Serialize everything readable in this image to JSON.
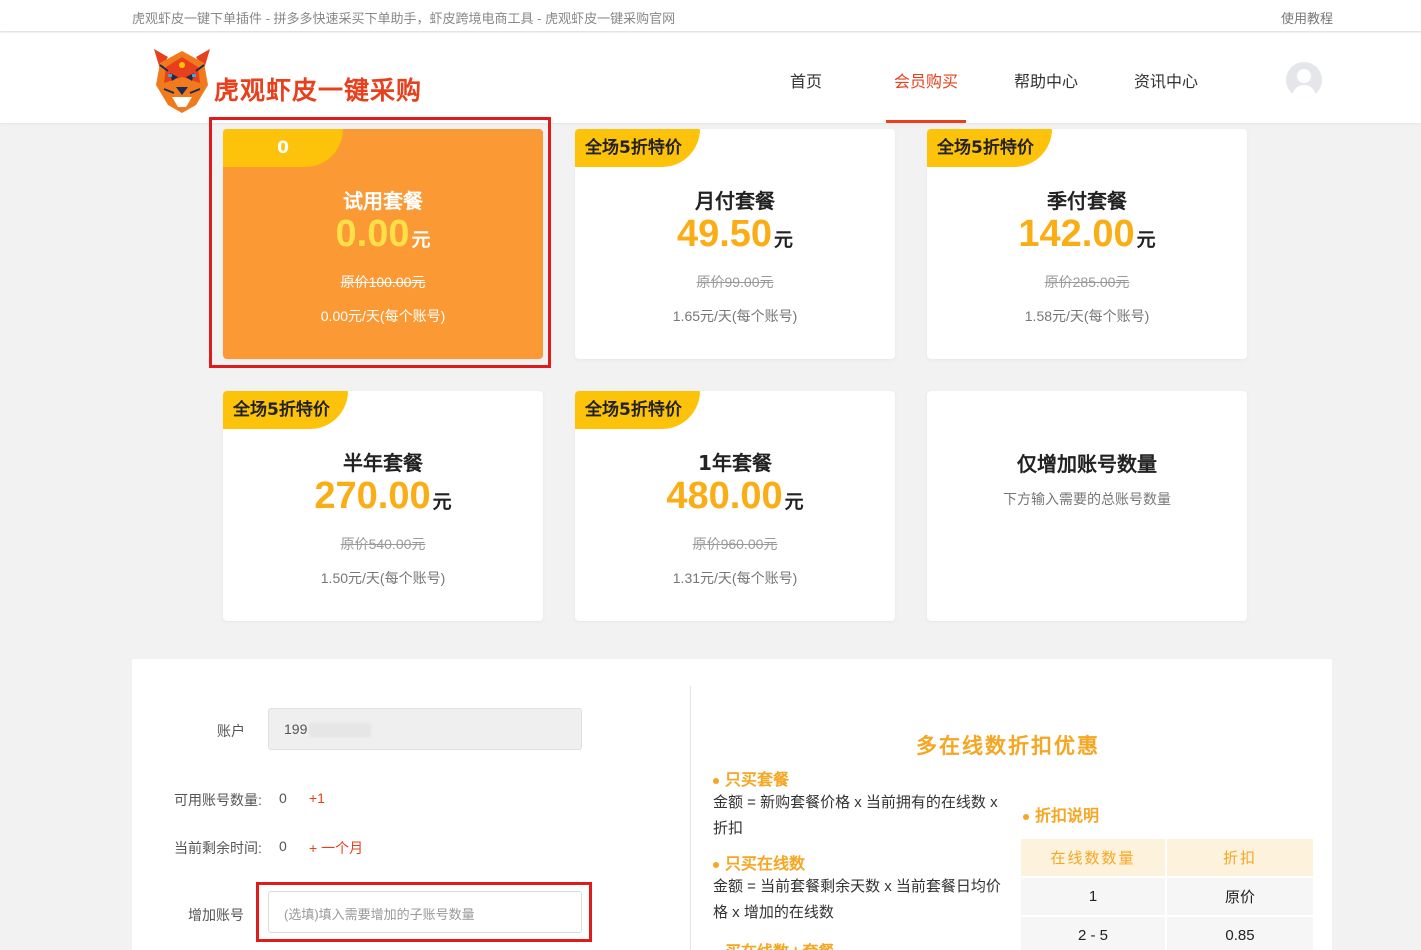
{
  "topbar": {
    "tagline": "虎观虾皮一键下单插件 - 拼多多快速采买下单助手，虾皮跨境电商工具 - 虎观虾皮一键采购官网",
    "tutorial": "使用教程"
  },
  "brand": {
    "name": "虎观虾皮一键采购"
  },
  "nav": {
    "items": [
      "首页",
      "会员购买",
      "帮助中心",
      "资讯中心"
    ],
    "active": "会员购买"
  },
  "plans": [
    {
      "badge": "0",
      "name": "试用套餐",
      "price": "0.00",
      "unit": "元",
      "original": "原价100.00元",
      "per_day": "0.00元/天(每个账号)",
      "selected": true
    },
    {
      "badge": "全场5折特价",
      "name": "月付套餐",
      "price": "49.50",
      "unit": "元",
      "original": "原价99.00元",
      "per_day": "1.65元/天(每个账号)"
    },
    {
      "badge": "全场5折特价",
      "name": "季付套餐",
      "price": "142.00",
      "unit": "元",
      "original": "原价285.00元",
      "per_day": "1.58元/天(每个账号)"
    },
    {
      "badge": "全场5折特价",
      "name": "半年套餐",
      "price": "270.00",
      "unit": "元",
      "original": "原价540.00元",
      "per_day": "1.50元/天(每个账号)"
    },
    {
      "badge": "全场5折特价",
      "name": "1年套餐",
      "price": "480.00",
      "unit": "元",
      "original": "原价960.00元",
      "per_day": "1.31元/天(每个账号)"
    },
    {
      "name": "仅增加账号数量",
      "desc": "下方输入需要的总账号数量"
    }
  ],
  "form": {
    "account_label": "账户",
    "account_value": "199",
    "available_label": "可用账号数量:",
    "available_value": "0",
    "available_add": "+1",
    "remaining_label": "当前剩余时间:",
    "remaining_value": "0",
    "remaining_add": "+ 一个月",
    "add_account_label": "增加账号",
    "add_account_placeholder": "(选填)填入需要增加的子账号数量"
  },
  "discount": {
    "title": "多在线数折扣优惠",
    "package_only_title": "只买套餐",
    "package_only_formula": "金额 = 新购套餐价格 x 当前拥有的在线数 x 折扣",
    "online_only_title": "只买在线数",
    "online_only_formula": "金额 = 当前套餐剩余天数 x 当前套餐日均价格 x 增加的在线数",
    "both_title": "买在线数+套餐",
    "explain_title": "折扣说明",
    "table_headers": [
      "在线数数量",
      "折扣"
    ],
    "table_rows": [
      [
        "1",
        "原价"
      ],
      [
        "2 - 5",
        "0.85"
      ]
    ]
  },
  "colors": {
    "accent": "#e8401c",
    "orange": "#fb9934",
    "gold": "#fdc20a",
    "price": "#fbad15",
    "highlight_border": "#e01b1b"
  }
}
